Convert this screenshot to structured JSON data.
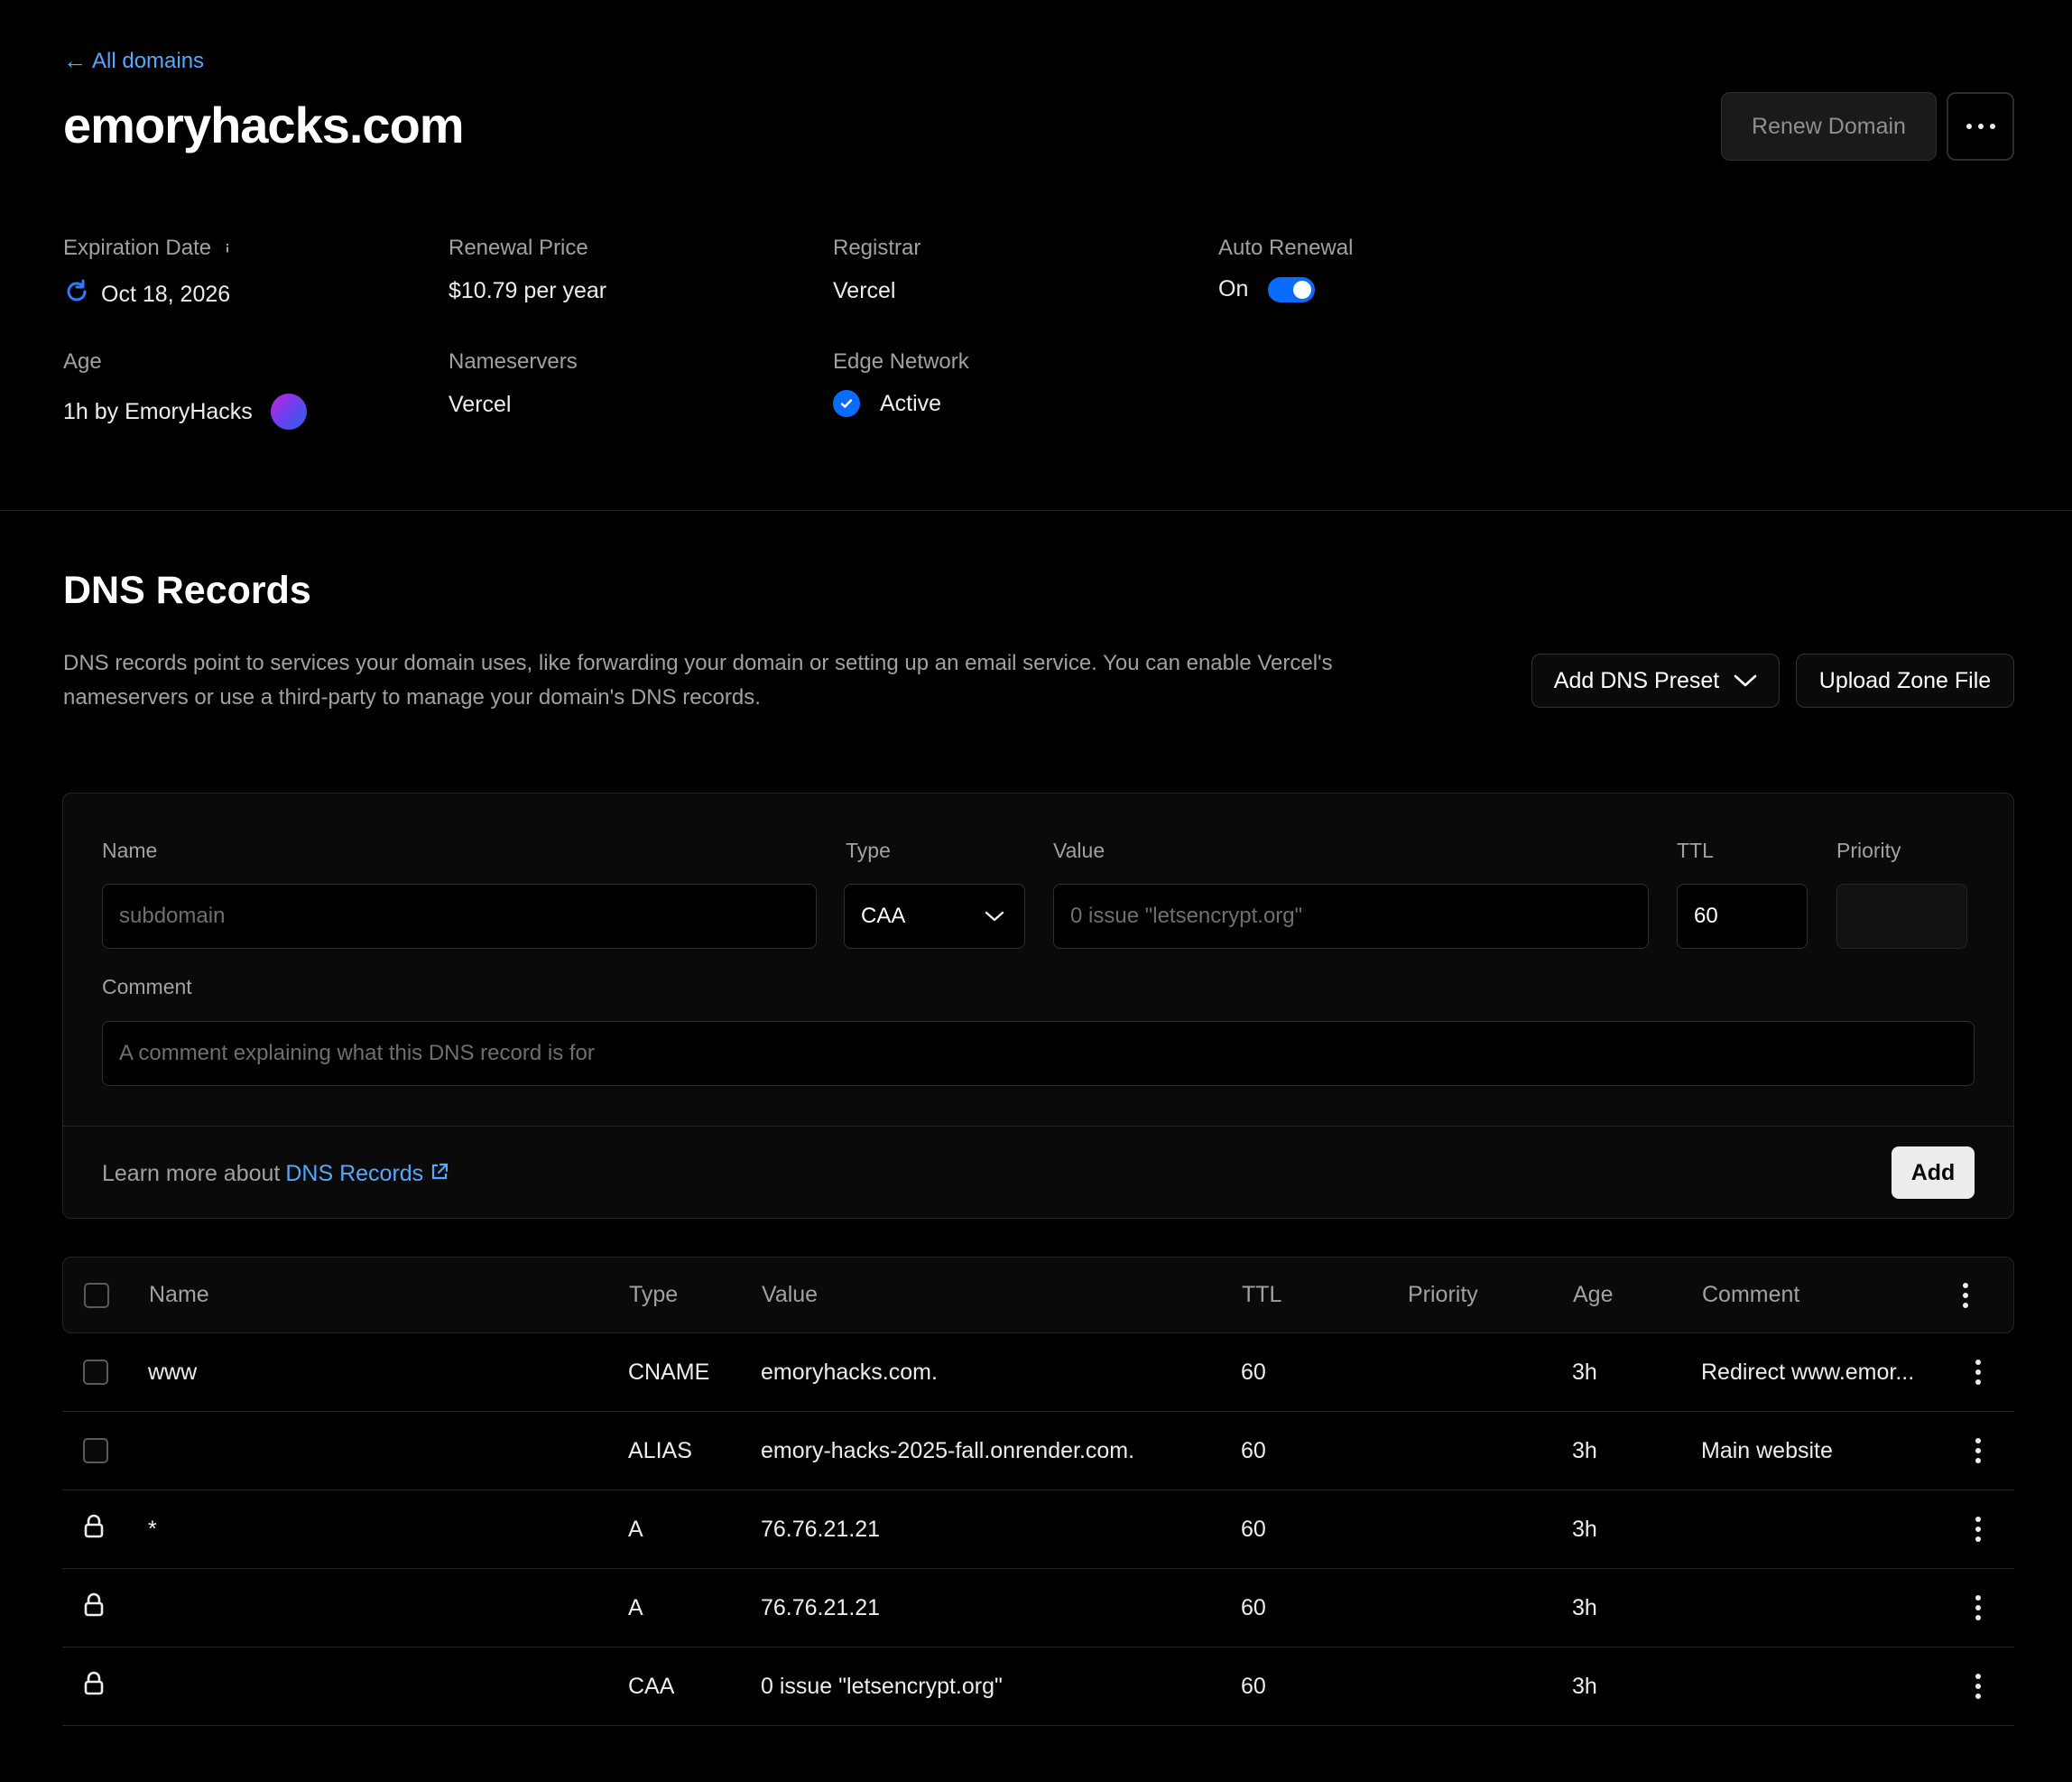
{
  "header": {
    "back_label": "All domains",
    "back_arrow": "←",
    "domain": "emoryhacks.com",
    "renew_label": "Renew Domain"
  },
  "info": {
    "expiration_label": "Expiration Date",
    "expiration_value": "Oct 18, 2026",
    "renewal_price_label": "Renewal Price",
    "renewal_price_value": "$10.79 per year",
    "registrar_label": "Registrar",
    "registrar_value": "Vercel",
    "auto_renewal_label": "Auto Renewal",
    "auto_renewal_value": "On",
    "age_label": "Age",
    "age_value": "1h by EmoryHacks",
    "nameservers_label": "Nameservers",
    "nameservers_value": "Vercel",
    "edge_network_label": "Edge Network",
    "edge_network_value": "Active"
  },
  "dns": {
    "title": "DNS Records",
    "description": "DNS records point to services your domain uses, like forwarding your domain or setting up an email service. You can enable Vercel's nameservers or use a third-party to manage your domain's DNS records.",
    "add_preset_label": "Add DNS Preset",
    "upload_zone_label": "Upload Zone File"
  },
  "form": {
    "name_label": "Name",
    "name_placeholder": "subdomain",
    "type_label": "Type",
    "type_value": "CAA",
    "value_label": "Value",
    "value_placeholder": "0 issue \"letsencrypt.org\"",
    "ttl_label": "TTL",
    "ttl_value": "60",
    "priority_label": "Priority",
    "comment_label": "Comment",
    "comment_placeholder": "A comment explaining what this DNS record is for",
    "learn_more_text": "Learn more about",
    "learn_more_link": "DNS Records",
    "add_label": "Add"
  },
  "table": {
    "headers": {
      "name": "Name",
      "type": "Type",
      "value": "Value",
      "ttl": "TTL",
      "priority": "Priority",
      "age": "Age",
      "comment": "Comment"
    },
    "rows": [
      {
        "locked": false,
        "name": "www",
        "type": "CNAME",
        "value": "emoryhacks.com.",
        "ttl": "60",
        "priority": "",
        "age": "3h",
        "comment": "Redirect www.emor..."
      },
      {
        "locked": false,
        "name": "",
        "type": "ALIAS",
        "value": "emory-hacks-2025-fall.onrender.com.",
        "ttl": "60",
        "priority": "",
        "age": "3h",
        "comment": "Main website"
      },
      {
        "locked": true,
        "name": "*",
        "type": "A",
        "value": "76.76.21.21",
        "ttl": "60",
        "priority": "",
        "age": "3h",
        "comment": ""
      },
      {
        "locked": true,
        "name": "",
        "type": "A",
        "value": "76.76.21.21",
        "ttl": "60",
        "priority": "",
        "age": "3h",
        "comment": ""
      },
      {
        "locked": true,
        "name": "",
        "type": "CAA",
        "value": "0 issue \"letsencrypt.org\"",
        "ttl": "60",
        "priority": "",
        "age": "3h",
        "comment": ""
      }
    ]
  },
  "colors": {
    "background": "#000000",
    "accent_link": "#52a8ff",
    "toggle_on": "#0a6cff",
    "text_primary": "#ededed",
    "text_secondary": "#a1a1a1"
  },
  "icons": {
    "refresh": "refresh-icon",
    "info": "info-icon",
    "check": "check-circle-icon",
    "external_link": "external-link-icon",
    "chevron": "chevron-down-icon",
    "lock": "lock-icon",
    "more_horizontal": "more-horizontal-icon",
    "more_vertical": "more-vertical-icon"
  }
}
